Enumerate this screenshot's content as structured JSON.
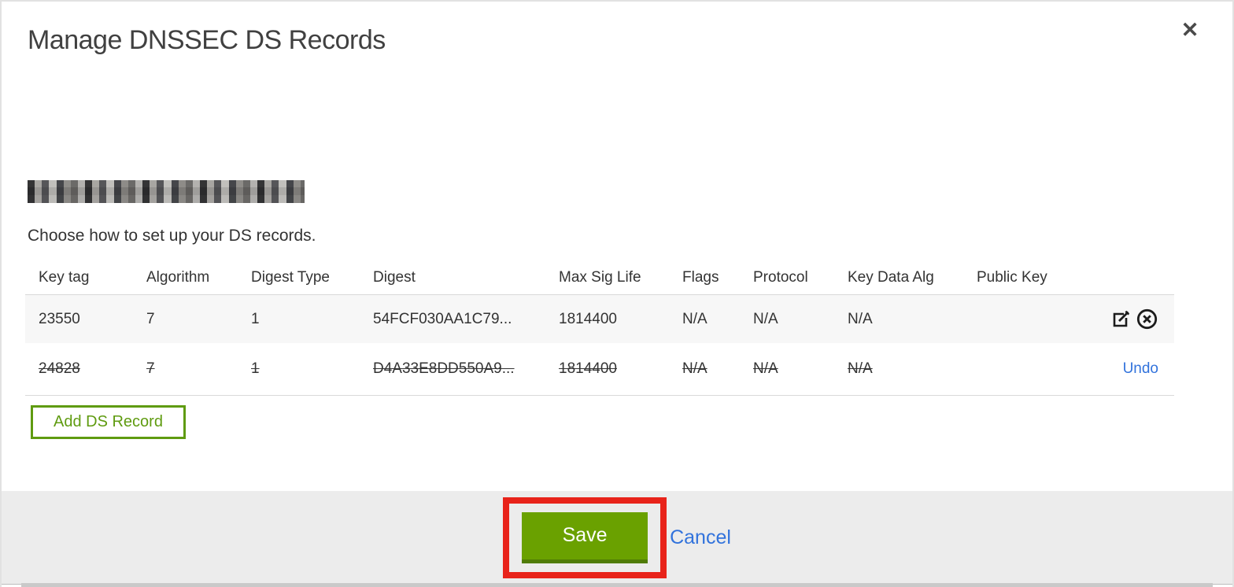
{
  "modal": {
    "title": "Manage DNSSEC DS Records",
    "close_glyph": "✕",
    "intro": "Choose how to set up your DS records.",
    "add_record_label": "Add DS Record",
    "table": {
      "headers": {
        "key_tag": "Key tag",
        "algorithm": "Algorithm",
        "digest_type": "Digest Type",
        "digest": "Digest",
        "max_sig_life": "Max Sig Life",
        "flags": "Flags",
        "protocol": "Protocol",
        "key_data_alg": "Key Data Alg",
        "public_key": "Public Key"
      },
      "rows": [
        {
          "key_tag": "23550",
          "algorithm": "7",
          "digest_type": "1",
          "digest": "54FCF030AA1C79...",
          "max_sig_life": "1814400",
          "flags": "N/A",
          "protocol": "N/A",
          "key_data_alg": "N/A",
          "public_key": "",
          "status": "active"
        },
        {
          "key_tag": "24828",
          "algorithm": "7",
          "digest_type": "1",
          "digest": "D4A33E8DD550A9...",
          "max_sig_life": "1814400",
          "flags": "N/A",
          "protocol": "N/A",
          "key_data_alg": "N/A",
          "public_key": "",
          "status": "marked-for-deletion",
          "undo_label": "Undo"
        }
      ]
    },
    "footer": {
      "save_label": "Save",
      "cancel_label": "Cancel"
    }
  },
  "colors": {
    "primary_green": "#6aa100",
    "green_border_dark": "#507c07",
    "outline_button_green": "#5f9b10",
    "link_blue": "#3273dc",
    "annotation_red": "#e8231a",
    "row_stripe": "#f7f7f7",
    "footer_bg": "#ececec",
    "title_text": "#404040"
  }
}
